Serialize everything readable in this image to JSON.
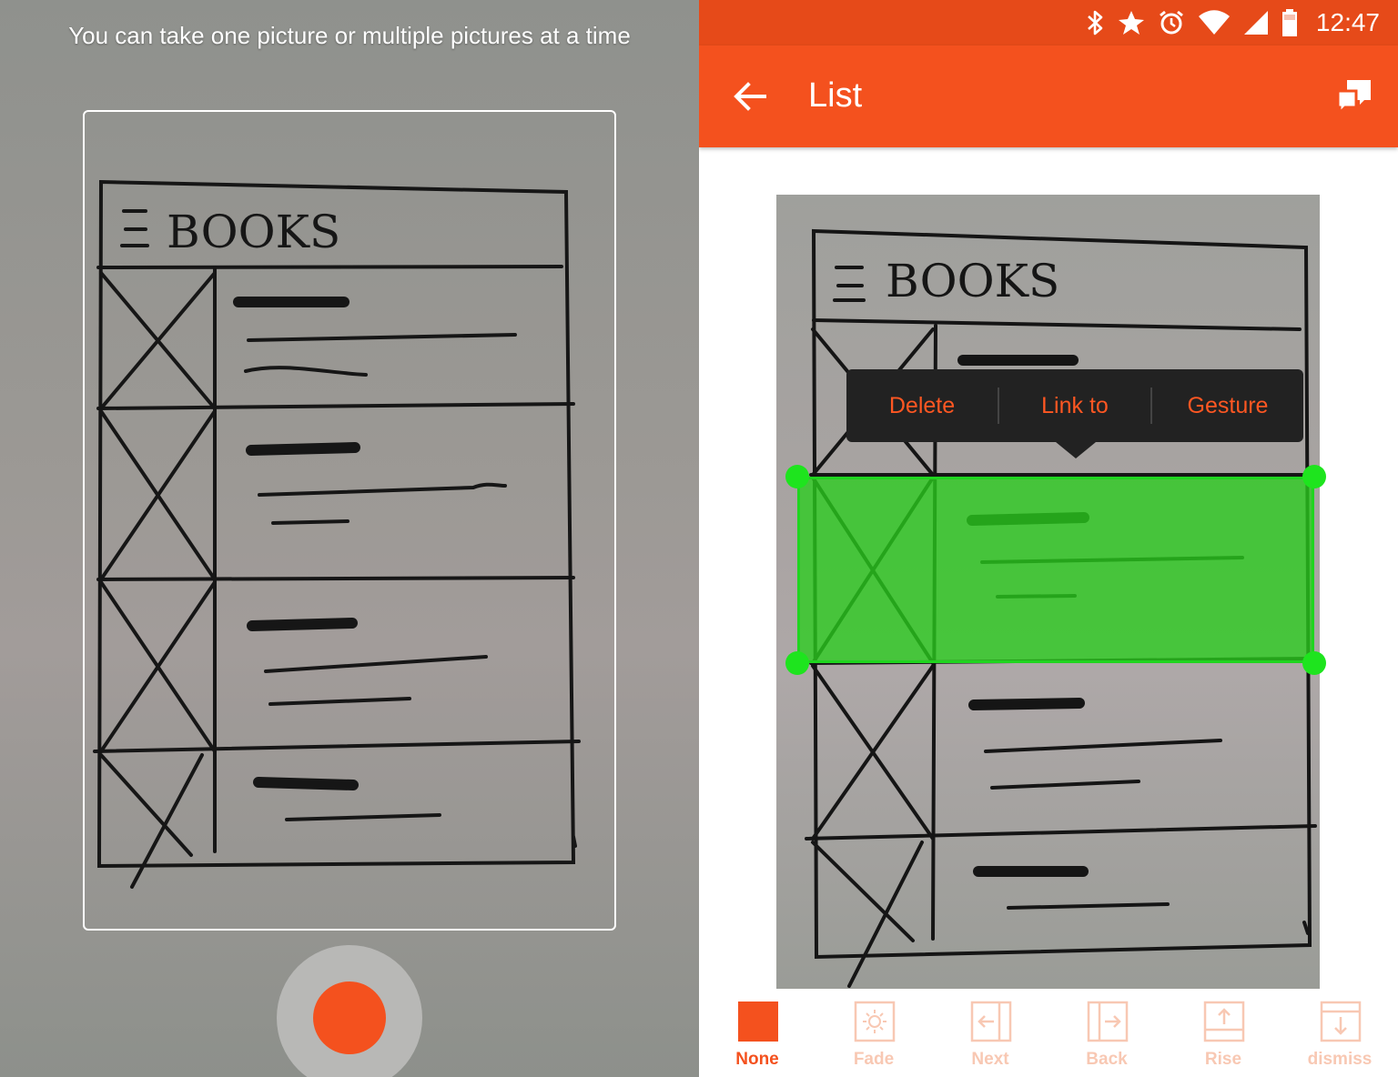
{
  "camera": {
    "hint": "You can take one picture or multiple pictures at a time",
    "sketch_title": "☰ BOOKS"
  },
  "status_bar": {
    "time": "12:47",
    "icons": [
      "bluetooth-icon",
      "star-icon",
      "alarm-icon",
      "wifi-icon",
      "signal-icon",
      "battery-icon"
    ]
  },
  "app_bar": {
    "title": "List",
    "back_icon": "arrow-left-icon",
    "action_icon": "feedback-icon"
  },
  "photo": {
    "sketch_title": "☰ BOOKS"
  },
  "context_menu": {
    "items": [
      "Delete",
      "Link to",
      "Gesture"
    ]
  },
  "toolbar": {
    "items": [
      {
        "label": "None",
        "icon": "square-icon",
        "active": true
      },
      {
        "label": "Fade",
        "icon": "sun-icon",
        "active": false
      },
      {
        "label": "Next",
        "icon": "arrow-left-into-panel-icon",
        "active": false
      },
      {
        "label": "Back",
        "icon": "arrow-right-into-panel-icon",
        "active": false
      },
      {
        "label": "Rise",
        "icon": "arrow-up-icon",
        "active": false
      },
      {
        "label": "dismiss",
        "icon": "arrow-down-icon",
        "active": false
      }
    ]
  },
  "colors": {
    "accent": "#f4511e",
    "status_bar": "#e64a19",
    "selection": "#2acd1e",
    "menu_bg": "#222222"
  }
}
